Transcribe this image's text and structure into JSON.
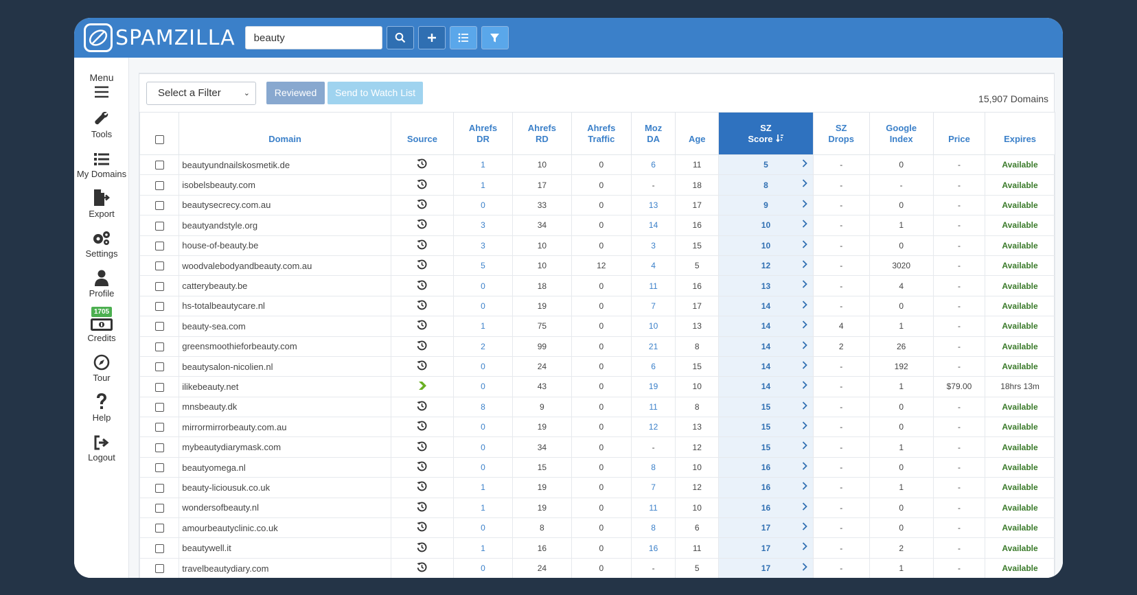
{
  "brand": {
    "name": "SPAMZILLA"
  },
  "search": {
    "value": "beauty"
  },
  "sidebar": [
    {
      "key": "menu",
      "label": "Menu"
    },
    {
      "key": "tools",
      "label": "Tools"
    },
    {
      "key": "mydomains",
      "label": "My Domains"
    },
    {
      "key": "export",
      "label": "Export"
    },
    {
      "key": "settings",
      "label": "Settings"
    },
    {
      "key": "profile",
      "label": "Profile"
    },
    {
      "key": "credits",
      "label": "Credits",
      "badge": "1705"
    },
    {
      "key": "tour",
      "label": "Tour"
    },
    {
      "key": "help",
      "label": "Help"
    },
    {
      "key": "logout",
      "label": "Logout"
    }
  ],
  "filters": {
    "select_label": "Select a Filter",
    "reviewed_label": "Reviewed",
    "watchlist_label": "Send to Watch List",
    "domain_count": "15,907 Domains"
  },
  "columns": [
    {
      "key": "domain",
      "lines": [
        "Domain"
      ]
    },
    {
      "key": "source",
      "lines": [
        "Source"
      ]
    },
    {
      "key": "dr",
      "lines": [
        "Ahrefs",
        "DR"
      ]
    },
    {
      "key": "rd",
      "lines": [
        "Ahrefs",
        "RD"
      ]
    },
    {
      "key": "traffic",
      "lines": [
        "Ahrefs",
        "Traffic"
      ]
    },
    {
      "key": "da",
      "lines": [
        "Moz",
        "DA"
      ]
    },
    {
      "key": "age",
      "lines": [
        "Age"
      ]
    },
    {
      "key": "sz",
      "lines": [
        "SZ",
        "Score"
      ],
      "sorted": true
    },
    {
      "key": "drops",
      "lines": [
        "SZ",
        "Drops"
      ]
    },
    {
      "key": "gindex",
      "lines": [
        "Google",
        "Index"
      ]
    },
    {
      "key": "price",
      "lines": [
        "Price"
      ]
    },
    {
      "key": "expires",
      "lines": [
        "Expires"
      ]
    }
  ],
  "rows": [
    {
      "domain": "beautyundnailskosmetik.de",
      "source": "history",
      "dr": "1",
      "rd": "10",
      "traffic": "0",
      "da": "6",
      "age": "11",
      "sz": "5",
      "drops": "-",
      "gindex": "0",
      "price": "-",
      "expires": "Available"
    },
    {
      "domain": "isobelsbeauty.com",
      "source": "history",
      "dr": "1",
      "rd": "17",
      "traffic": "0",
      "da": "-",
      "age": "18",
      "sz": "8",
      "drops": "-",
      "gindex": "-",
      "price": "-",
      "expires": "Available"
    },
    {
      "domain": "beautysecrecy.com.au",
      "source": "history",
      "dr": "0",
      "rd": "33",
      "traffic": "0",
      "da": "13",
      "age": "17",
      "sz": "9",
      "drops": "-",
      "gindex": "0",
      "price": "-",
      "expires": "Available"
    },
    {
      "domain": "beautyandstyle.org",
      "source": "history",
      "dr": "3",
      "rd": "34",
      "traffic": "0",
      "da": "14",
      "age": "16",
      "sz": "10",
      "drops": "-",
      "gindex": "1",
      "price": "-",
      "expires": "Available"
    },
    {
      "domain": "house-of-beauty.be",
      "source": "history",
      "dr": "3",
      "rd": "10",
      "traffic": "0",
      "da": "3",
      "age": "15",
      "sz": "10",
      "drops": "-",
      "gindex": "0",
      "price": "-",
      "expires": "Available"
    },
    {
      "domain": "woodvalebodyandbeauty.com.au",
      "source": "history",
      "dr": "5",
      "rd": "10",
      "traffic": "12",
      "da": "4",
      "age": "5",
      "sz": "12",
      "drops": "-",
      "gindex": "3020",
      "price": "-",
      "expires": "Available"
    },
    {
      "domain": "catterybeauty.be",
      "source": "history",
      "dr": "0",
      "rd": "18",
      "traffic": "0",
      "da": "11",
      "age": "16",
      "sz": "13",
      "drops": "-",
      "gindex": "4",
      "price": "-",
      "expires": "Available"
    },
    {
      "domain": "hs-totalbeautycare.nl",
      "source": "history",
      "dr": "0",
      "rd": "19",
      "traffic": "0",
      "da": "7",
      "age": "17",
      "sz": "14",
      "drops": "-",
      "gindex": "0",
      "price": "-",
      "expires": "Available"
    },
    {
      "domain": "beauty-sea.com",
      "source": "history",
      "dr": "1",
      "rd": "75",
      "traffic": "0",
      "da": "10",
      "age": "13",
      "sz": "14",
      "drops": "4",
      "gindex": "1",
      "price": "-",
      "expires": "Available"
    },
    {
      "domain": "greensmoothieforbeauty.com",
      "source": "history",
      "dr": "2",
      "rd": "99",
      "traffic": "0",
      "da": "21",
      "age": "8",
      "sz": "14",
      "drops": "2",
      "gindex": "26",
      "price": "-",
      "expires": "Available"
    },
    {
      "domain": "beautysalon-nicolien.nl",
      "source": "history",
      "dr": "0",
      "rd": "24",
      "traffic": "0",
      "da": "6",
      "age": "15",
      "sz": "14",
      "drops": "-",
      "gindex": "192",
      "price": "-",
      "expires": "Available"
    },
    {
      "domain": "ilikebeauty.net",
      "source": "arrow",
      "dr": "0",
      "rd": "43",
      "traffic": "0",
      "da": "19",
      "age": "10",
      "sz": "14",
      "drops": "-",
      "gindex": "1",
      "price": "$79.00",
      "expires": "18hrs 13m"
    },
    {
      "domain": "mnsbeauty.dk",
      "source": "history",
      "dr": "8",
      "rd": "9",
      "traffic": "0",
      "da": "11",
      "age": "8",
      "sz": "15",
      "drops": "-",
      "gindex": "0",
      "price": "-",
      "expires": "Available"
    },
    {
      "domain": "mirrormirrorbeauty.com.au",
      "source": "history",
      "dr": "0",
      "rd": "19",
      "traffic": "0",
      "da": "12",
      "age": "13",
      "sz": "15",
      "drops": "-",
      "gindex": "0",
      "price": "-",
      "expires": "Available"
    },
    {
      "domain": "mybeautydiarymask.com",
      "source": "history",
      "dr": "0",
      "rd": "34",
      "traffic": "0",
      "da": "-",
      "age": "12",
      "sz": "15",
      "drops": "-",
      "gindex": "1",
      "price": "-",
      "expires": "Available"
    },
    {
      "domain": "beautyomega.nl",
      "source": "history",
      "dr": "0",
      "rd": "15",
      "traffic": "0",
      "da": "8",
      "age": "10",
      "sz": "16",
      "drops": "-",
      "gindex": "0",
      "price": "-",
      "expires": "Available"
    },
    {
      "domain": "beauty-liciousuk.co.uk",
      "source": "history",
      "dr": "1",
      "rd": "19",
      "traffic": "0",
      "da": "7",
      "age": "12",
      "sz": "16",
      "drops": "-",
      "gindex": "1",
      "price": "-",
      "expires": "Available"
    },
    {
      "domain": "wondersofbeauty.nl",
      "source": "history",
      "dr": "1",
      "rd": "19",
      "traffic": "0",
      "da": "11",
      "age": "10",
      "sz": "16",
      "drops": "-",
      "gindex": "0",
      "price": "-",
      "expires": "Available"
    },
    {
      "domain": "amourbeautyclinic.co.uk",
      "source": "history",
      "dr": "0",
      "rd": "8",
      "traffic": "0",
      "da": "8",
      "age": "6",
      "sz": "17",
      "drops": "-",
      "gindex": "0",
      "price": "-",
      "expires": "Available"
    },
    {
      "domain": "beautywell.it",
      "source": "history",
      "dr": "1",
      "rd": "16",
      "traffic": "0",
      "da": "16",
      "age": "11",
      "sz": "17",
      "drops": "-",
      "gindex": "2",
      "price": "-",
      "expires": "Available"
    },
    {
      "domain": "travelbeautydiary.com",
      "source": "history",
      "dr": "0",
      "rd": "24",
      "traffic": "0",
      "da": "-",
      "age": "5",
      "sz": "17",
      "drops": "-",
      "gindex": "1",
      "price": "-",
      "expires": "Available"
    }
  ],
  "colors": {
    "brand_blue": "#3b80c9",
    "sorted_header": "#2f72bf",
    "available_green": "#3a7a2a",
    "credits_badge": "#4caf50",
    "source_arrow": "#6ab023"
  }
}
